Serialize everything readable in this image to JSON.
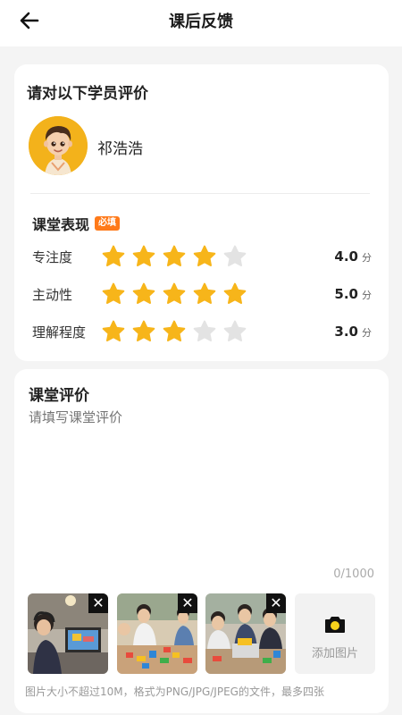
{
  "header": {
    "title": "课后反馈"
  },
  "student_card": {
    "heading": "请对以下学员评价",
    "student_name": "祁浩浩",
    "performance": {
      "title": "课堂表现",
      "required_badge": "必填",
      "ratings": [
        {
          "label": "专注度",
          "stars": 4,
          "max": 5,
          "score": "4.0",
          "unit": "分"
        },
        {
          "label": "主动性",
          "stars": 5,
          "max": 5,
          "score": "5.0",
          "unit": "分"
        },
        {
          "label": "理解程度",
          "stars": 3,
          "max": 5,
          "score": "3.0",
          "unit": "分"
        }
      ]
    }
  },
  "comment_card": {
    "heading": "课堂评价",
    "placeholder": "请填写课堂评价",
    "counter": "0/1000",
    "photos": [
      "robot-class-photo-1",
      "robot-class-photo-2",
      "robot-class-photo-3"
    ],
    "add_photo_label": "添加图片",
    "hint": "图片大小不超过10M，格式为PNG/JPG/JPEG的文件，最多四张"
  },
  "colors": {
    "star_active": "#f7b51a",
    "star_inactive": "#e3e3e3",
    "badge": "#ff7a1a"
  }
}
